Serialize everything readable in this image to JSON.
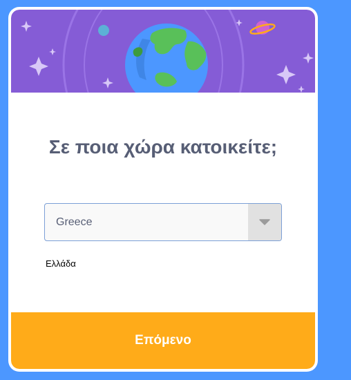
{
  "dialog": {
    "question": "Σε ποια χώρα κατοικείτε;",
    "country_select": {
      "selected": "Greece"
    },
    "selected_country_native": "Ελλάδα",
    "next_label": "Επόμενο"
  },
  "colors": {
    "background": "#4c97ff",
    "header": "#855cd6",
    "title_text": "#575e75",
    "next_button": "#ffab19",
    "select_border": "#7b9fd6"
  },
  "icons": {
    "header_art": "globe-space-illustration",
    "dropdown": "chevron-down-icon"
  }
}
